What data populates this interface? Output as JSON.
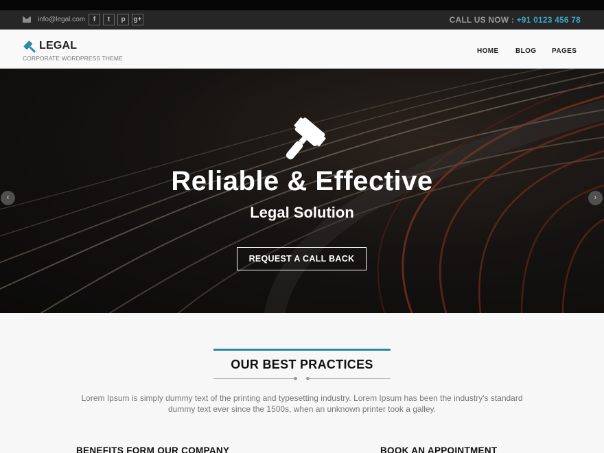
{
  "topbar": {
    "email": "info@legal.com",
    "social": [
      "f",
      "t",
      "p",
      "g+"
    ],
    "call_label": "CALL US NOW : ",
    "phone": "+91 0123 456 78"
  },
  "header": {
    "logo": "LEGAL",
    "tagline": "CORPORATE WORDPRESS THEME",
    "nav": [
      "HOME",
      "BLOG",
      "PAGES"
    ]
  },
  "hero": {
    "title": "Reliable & Effective",
    "subtitle": "Legal Solution",
    "cta": "REQUEST A CALL BACK",
    "prev": "‹",
    "next": "›"
  },
  "practices": {
    "title": "OUR BEST PRACTICES",
    "description": "Lorem Ipsum is simply dummy text of the printing and typesetting industry. Lorem Ipsum has been the industry's standard dummy text ever since the 1500s, when an unknown printer took a galley.",
    "col_left": "BENEFITS FORM OUR COMPANY",
    "col_right": "BOOK AN APPOINTMENT"
  },
  "colors": {
    "accent": "#2a8ca1",
    "phone": "#3ea6c2",
    "topbar": "#262626"
  },
  "icons": [
    "mail-icon",
    "facebook-icon",
    "twitter-icon",
    "pinterest-icon",
    "google-plus-icon",
    "gavel-icon",
    "chevron-left-icon",
    "chevron-right-icon"
  ]
}
